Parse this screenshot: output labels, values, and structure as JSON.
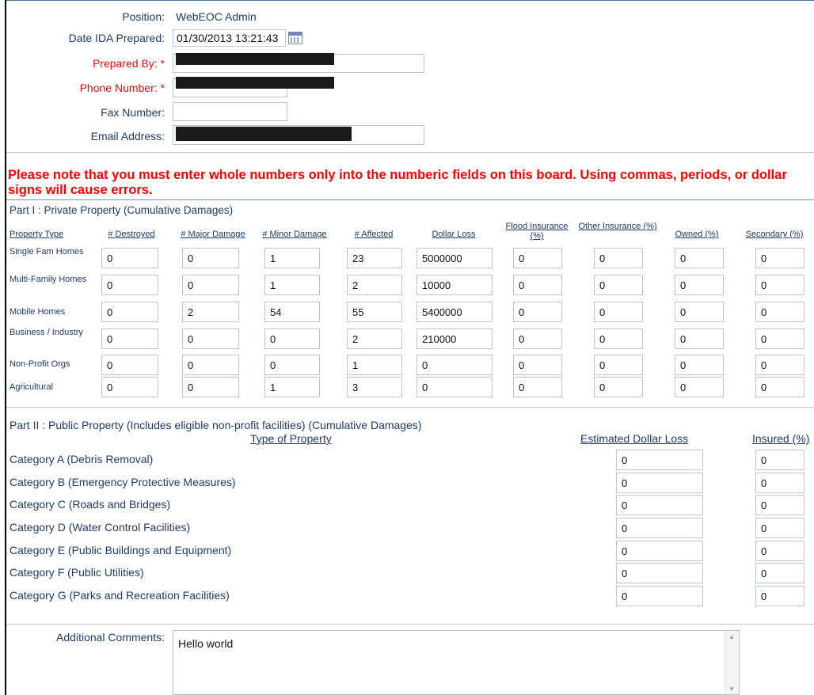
{
  "header": {
    "position_label": "Position:",
    "position_value": "WebEOC Admin",
    "date_label": "Date IDA Prepared:",
    "date_value": "01/30/2013 13:21:43",
    "prepared_by_label": "Prepared By:",
    "phone_label": "Phone Number:",
    "fax_label": "Fax Number:",
    "email_label": "Email Address:",
    "required_mark": "*"
  },
  "warning": "Please note that you must enter whole numbers only into the numberic fields on this board. Using commas, periods, or dollar signs will cause errors.",
  "part1": {
    "title": "Part I : Private Property (Cumulative Damages)",
    "columns": [
      "Property Type",
      "# Destroyed",
      "# Major Damage",
      "# Minor Damage",
      "# Affected",
      "Dollar Loss",
      "Flood Insurance (%)",
      "Other Insurance (%)",
      "Owned (%)",
      "Secondary (%)"
    ],
    "rows": [
      {
        "label": "Single Fam Homes",
        "values": [
          "0",
          "0",
          "1",
          "23",
          "5000000",
          "0",
          "0",
          "0",
          "0"
        ]
      },
      {
        "label": "Multi-Family Homes",
        "values": [
          "0",
          "0",
          "1",
          "2",
          "10000",
          "0",
          "0",
          "0",
          "0"
        ]
      },
      {
        "label": "Mobile Homes",
        "values": [
          "0",
          "2",
          "54",
          "55",
          "5400000",
          "0",
          "0",
          "0",
          "0"
        ]
      },
      {
        "label": "Business / Industry",
        "values": [
          "0",
          "0",
          "0",
          "2",
          "210000",
          "0",
          "0",
          "0",
          "0"
        ]
      },
      {
        "label": "Non-Profit Orgs",
        "values": [
          "0",
          "0",
          "0",
          "1",
          "0",
          "0",
          "0",
          "0",
          "0"
        ]
      },
      {
        "label": "Agricultural",
        "values": [
          "0",
          "0",
          "1",
          "3",
          "0",
          "0",
          "0",
          "0",
          "0"
        ]
      }
    ]
  },
  "part2": {
    "title": "Part II : Public Property (Includes eligible non-profit facilities) (Cumulative Damages)",
    "col_type": "Type of Property",
    "col_loss": "Estimated Dollar Loss",
    "col_insured": "Insured (%)",
    "rows": [
      {
        "label": "Category A (Debris Removal)",
        "loss": "0",
        "insured": "0"
      },
      {
        "label": "Category B (Emergency Protective Measures)",
        "loss": "0",
        "insured": "0"
      },
      {
        "label": "Category C (Roads and Bridges)",
        "loss": "0",
        "insured": "0"
      },
      {
        "label": "Category D (Water Control Facilities)",
        "loss": "0",
        "insured": "0"
      },
      {
        "label": "Category E (Public Buildings and Equipment)",
        "loss": "0",
        "insured": "0"
      },
      {
        "label": "Category F (Public Utilities)",
        "loss": "0",
        "insured": "0"
      },
      {
        "label": "Category G (Parks and Recreation Facilities)",
        "loss": "0",
        "insured": "0"
      }
    ]
  },
  "comments": {
    "label": "Additional Comments:",
    "value": "Hello world"
  }
}
